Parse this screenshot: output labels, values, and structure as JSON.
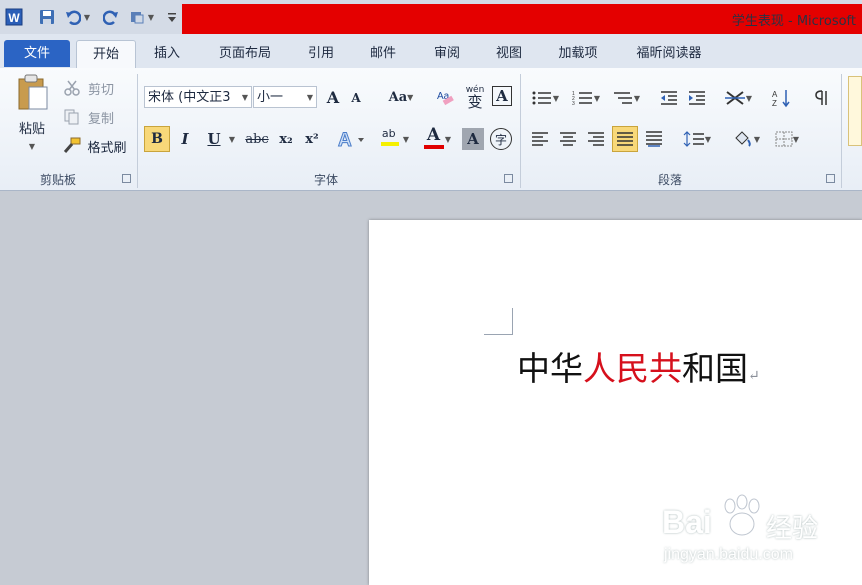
{
  "titlebar": {
    "title": "学生表现 - Microsoft ",
    "qat": [
      "word-icon",
      "save-icon",
      "undo-icon",
      "dropdown-icon",
      "redo-icon",
      "customize-icon",
      "dropdown-icon",
      "qat-menu-icon"
    ]
  },
  "tabs": [
    {
      "label": "文件"
    },
    {
      "label": "开始"
    },
    {
      "label": "插入"
    },
    {
      "label": "页面布局"
    },
    {
      "label": "引用"
    },
    {
      "label": "邮件"
    },
    {
      "label": "审阅"
    },
    {
      "label": "视图"
    },
    {
      "label": "加载项"
    },
    {
      "label": "福昕阅读器"
    }
  ],
  "clipboard": {
    "paste": "粘贴",
    "cut": "剪切",
    "copy": "复制",
    "format_painter": "格式刷",
    "label": "剪贴板"
  },
  "font": {
    "family": "宋体 (中文正3",
    "size": "小一",
    "label": "字体",
    "change_case": "Aa",
    "bold": "B",
    "italic": "I",
    "underline": "U",
    "strike": "abc",
    "subscript": "x₂",
    "superscript": "x²",
    "font_color_letter": "A",
    "char_shading_letter": "A",
    "enclose_char": "字",
    "phonetic": "wén",
    "phonetic_char": "变",
    "grow": "A",
    "shrink": "A",
    "border_letter": "A",
    "highlight_letters": "ab"
  },
  "paragraph": {
    "label": "段落"
  },
  "document": {
    "text_black_1": "中华",
    "text_red": "人民共",
    "text_black_2": "和国",
    "para_mark": "↵"
  },
  "watermark": {
    "brand": "Bai",
    "brand2": "经验",
    "url": "jingyan.baidu.com"
  },
  "colors": {
    "title_band": "#e40000",
    "file_tab": "#2b64c4",
    "red_text": "#d6101c",
    "font_color_bar": "#e00000",
    "highlight_bar": "#f5f000"
  }
}
